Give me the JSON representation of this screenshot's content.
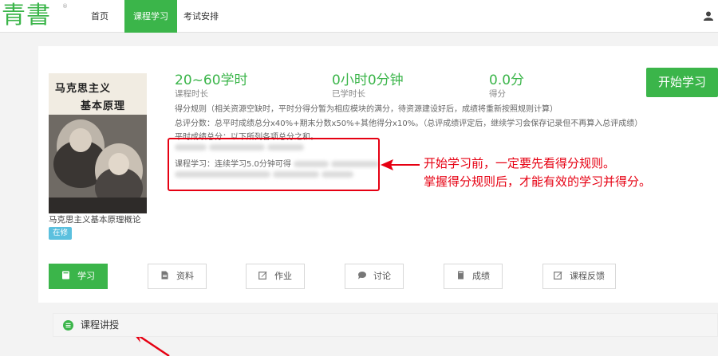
{
  "brand": {
    "logo_text": "青書",
    "reg_mark": "®"
  },
  "nav": {
    "items": [
      {
        "label": "首页"
      },
      {
        "label": "课程学习"
      },
      {
        "label": "考试安排"
      }
    ],
    "user_icon": "user-icon"
  },
  "course": {
    "cover": {
      "title_line1": "马克思主义",
      "title_line2": "基本原理"
    },
    "name": "马克思主义基本原理概论",
    "status": "在修",
    "start_button": "开始学习",
    "stats": [
      {
        "value": "20~60学时",
        "label": "课程时长"
      },
      {
        "value": "0小时0分钟",
        "label": "已学时长"
      },
      {
        "value": "0.0分",
        "label": "得分"
      }
    ],
    "rules": {
      "line1": "得分规则（相关资源空缺时，平时分得分暂为相应模块的满分，待资源建设好后，成绩将重新按照规则计算）",
      "line2": "总评分数：总平时成绩总分x40%+期末分数x50%+其他得分x10%。（总评成绩评定后，继续学习会保存记录但不再算入总评成绩）",
      "line3": "平时成绩总分：以下所列各项总分之和。",
      "line5": "课程学习：连续学习5.0分钟可得"
    }
  },
  "annotations": [
    "开始学习前，一定要先看得分规则。",
    "掌握得分规则后，才能有效的学习并得分。"
  ],
  "tabs": [
    {
      "label": "学习",
      "icon": "book-icon"
    },
    {
      "label": "资料",
      "icon": "document-icon"
    },
    {
      "label": "作业",
      "icon": "edit-icon"
    },
    {
      "label": "讨论",
      "icon": "chat-icon"
    },
    {
      "label": "成绩",
      "icon": "grade-icon"
    },
    {
      "label": "课程反馈",
      "icon": "feedback-icon"
    }
  ],
  "section": {
    "title": "课程讲授",
    "icon": "list-icon"
  },
  "colors": {
    "accent": "#3bb54a",
    "badge": "#5bc0de",
    "annotation": "#e60012"
  }
}
